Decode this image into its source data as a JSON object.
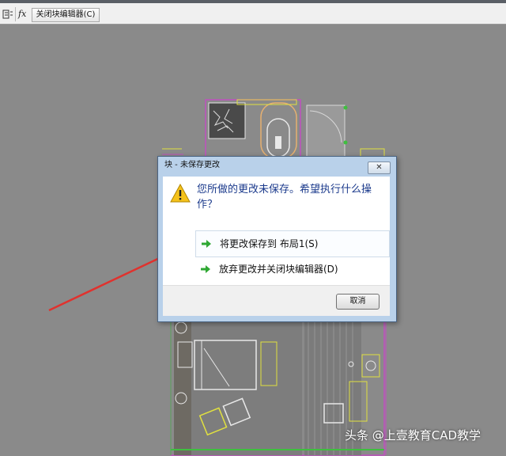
{
  "toolbar": {
    "icon1": "block-editor-icon",
    "icon2_text": "fx",
    "close_editor_label": "关闭块编辑器(C)"
  },
  "dialog": {
    "title": "块 - 未保存更改",
    "close_glyph": "✕",
    "question": "您所做的更改未保存。希望执行什么操作？",
    "options": [
      {
        "label": "将更改保存到 布局1(S)",
        "icon": "green-arrow-icon"
      },
      {
        "label": "放弃更改并关闭块编辑器(D)",
        "icon": "green-arrow-icon"
      }
    ],
    "cancel_label": "取消"
  },
  "watermark": "头条 @上壹教育CAD教学",
  "colors": {
    "canvas": "#8a8a8a",
    "annotation_arrow": "#e0322e",
    "question_text": "#1b3a8c",
    "option_arrow": "#2fa833"
  }
}
